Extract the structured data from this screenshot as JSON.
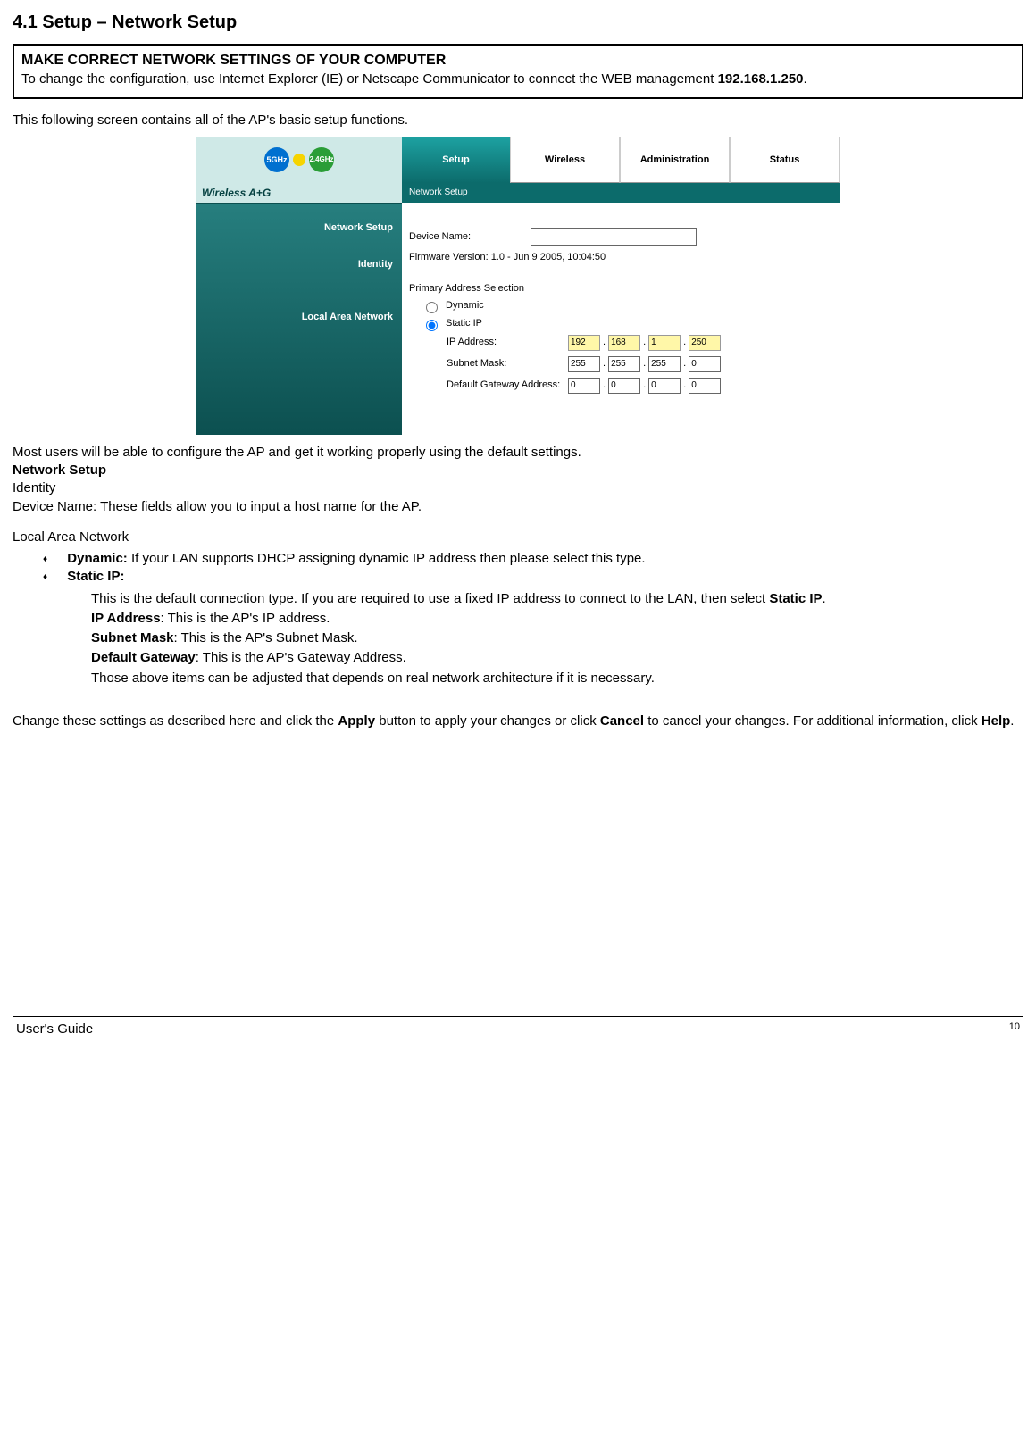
{
  "heading": "4.1 Setup – Network Setup",
  "note": {
    "title": "MAKE CORRECT NETWORK SETTINGS OF YOUR COMPUTER",
    "body_pre": "To change the configuration, use Internet Explorer (IE) or Netscape Communicator to connect the WEB management ",
    "ip": "192.168.1.250",
    "body_post": "."
  },
  "intro": "This following screen contains all of the AP's basic setup functions.",
  "screenshot": {
    "logo5": "5GHz",
    "logo24": "2.4GHz",
    "brand": "Wireless A+G",
    "tabs": [
      "Setup",
      "Wireless",
      "Administration",
      "Status"
    ],
    "subnav": "Network Setup",
    "left_labels": {
      "network_setup": "Network Setup",
      "identity": "Identity",
      "lan": "Local Area Network"
    },
    "device_name_label": "Device Name:",
    "device_name_value": "",
    "fw_label": "Firmware Version: 1.0 - Jun 9 2005, 10:04:50",
    "primary_label": "Primary Address Selection",
    "radio_dynamic": "Dynamic",
    "radio_static": "Static IP",
    "ip_label": "IP Address:",
    "ip": [
      "192",
      "168",
      "1",
      "250"
    ],
    "mask_label": "Subnet Mask:",
    "mask": [
      "255",
      "255",
      "255",
      "0"
    ],
    "gw_label": "Default Gateway Address:",
    "gw": [
      "0",
      "0",
      "0",
      "0"
    ]
  },
  "para_most": "Most users will be able to configure the AP and get it working properly using the default settings.",
  "ns_title": "Network Setup",
  "identity_title": "Identity",
  "device_name_text": "Device Name: These fields allow you to input a host name for the AP.",
  "lan_title": "Local Area Network",
  "bullets": {
    "dyn_label": "Dynamic:",
    "dyn_text": " If your LAN supports DHCP assigning dynamic IP address then please select this type.",
    "static_label": "Static IP:",
    "static_desc_pre": "This is the default connection type. If you are required to use a fixed IP address to connect to the LAN, then select ",
    "static_desc_bold": "Static IP",
    "static_desc_post": ".",
    "ipaddr_b": "IP Address",
    "ipaddr_t": ": This is the AP's IP address.",
    "mask_b": "Subnet Mask",
    "mask_t": ": This is the AP's Subnet Mask.",
    "gw_b": "Default Gateway",
    "gw_t": ": This is the AP's Gateway Address.",
    "adjust": "Those above items can be adjusted that depends on real network architecture if it is necessary."
  },
  "closing": {
    "pre": "Change these settings as described here and click the ",
    "apply": "Apply",
    "mid1": " button to apply your changes or click ",
    "cancel": "Cancel",
    "mid2": " to cancel your changes. For additional information, click ",
    "help": "Help",
    "post": "."
  },
  "footer": {
    "guide": "User's Guide",
    "page": "10"
  }
}
